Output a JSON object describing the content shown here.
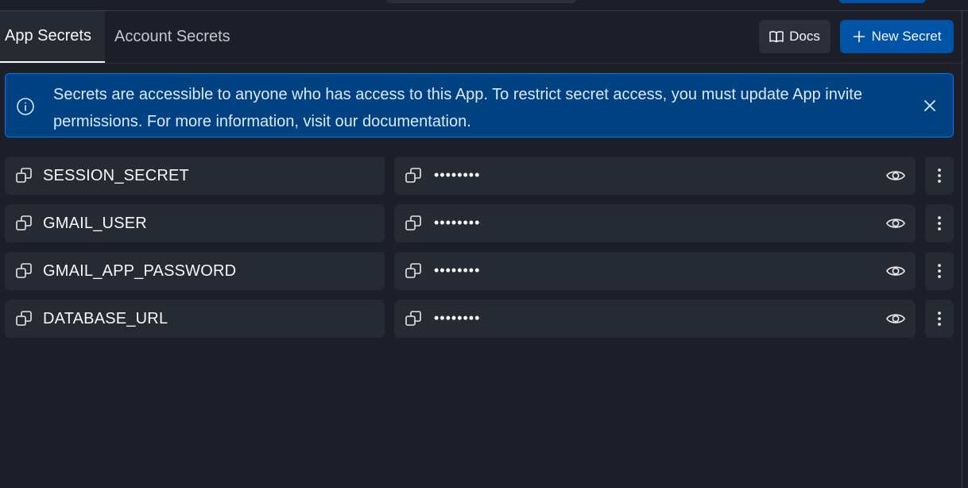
{
  "tabs": [
    {
      "label": "App Secrets",
      "active": true
    },
    {
      "label": "Account Secrets",
      "active": false
    }
  ],
  "toolbar": {
    "docs_label": "Docs",
    "new_secret_label": "New Secret"
  },
  "banner": {
    "text": "Secrets are accessible to anyone who has access to this App. To restrict secret access, you must update App invite permissions. For more information, visit our documentation."
  },
  "secrets": [
    {
      "key": "SESSION_SECRET",
      "value": "••••••••"
    },
    {
      "key": "GMAIL_USER",
      "value": "••••••••"
    },
    {
      "key": "GMAIL_APP_PASSWORD",
      "value": "••••••••"
    },
    {
      "key": "DATABASE_URL",
      "value": "••••••••"
    }
  ],
  "icons": {
    "info": "info-icon",
    "close": "close-icon",
    "copy": "copy-icon",
    "eye": "eye-icon",
    "menu": "more-vertical-icon",
    "book": "book-icon",
    "plus": "plus-icon"
  },
  "colors": {
    "background": "#1c1f27",
    "surface": "#262a33",
    "primary": "#0053a6",
    "banner_bg": "#004182",
    "banner_border": "#0079f2",
    "text": "#f5f9fc"
  }
}
